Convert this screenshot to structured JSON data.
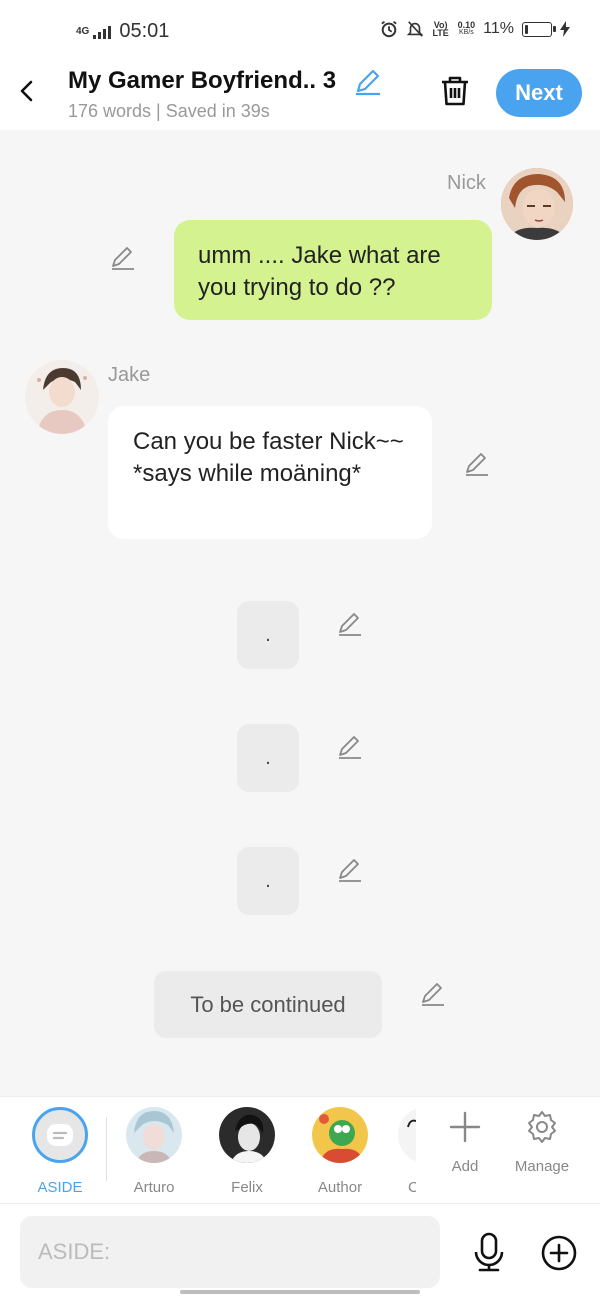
{
  "status_bar": {
    "network": "4G",
    "time": "05:01",
    "volte": "Vo) LTE",
    "speed_value": "0.10",
    "speed_unit": "KB/s",
    "battery_percent": "11%",
    "battery_level": 0.11,
    "icons": [
      "alarm-icon",
      "mute-icon",
      "charging-icon"
    ]
  },
  "header": {
    "title": "My Gamer Boyfriend.. 3",
    "subtitle": "176 words | Saved in 39s",
    "next_label": "Next",
    "accent_color": "#4aa3ef"
  },
  "messages": [
    {
      "type": "right",
      "name": "Nick",
      "text": "umm .... Jake what are you trying to do ??"
    },
    {
      "type": "left",
      "name": "Jake",
      "text": "Can you be faster Nick~~ *says while moäning*"
    },
    {
      "type": "center",
      "text": "."
    },
    {
      "type": "center",
      "text": "."
    },
    {
      "type": "center",
      "text": "."
    },
    {
      "type": "aside",
      "text": "To be continued"
    }
  ],
  "characters": [
    {
      "label": "ASIDE",
      "active": true
    },
    {
      "label": "Arturo"
    },
    {
      "label": "Felix"
    },
    {
      "label": "Author"
    },
    {
      "label": "C"
    }
  ],
  "actions": {
    "add_label": "Add",
    "manage_label": "Manage"
  },
  "input": {
    "placeholder": "ASIDE:"
  }
}
